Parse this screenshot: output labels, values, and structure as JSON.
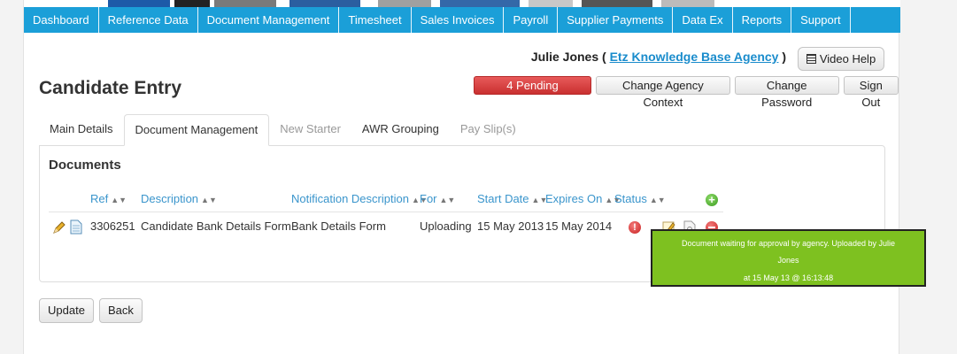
{
  "nav": {
    "items": [
      "Dashboard",
      "Reference Data",
      "Document Management",
      "Timesheet",
      "Sales Invoices",
      "Payroll",
      "Supplier Payments",
      "Data Ex",
      "Reports",
      "Support"
    ]
  },
  "header": {
    "user_name": "Julie Jones (",
    "agency": "Etz Knowledge Base Agency",
    "close_paren": ")",
    "video_help": "Video Help",
    "title": "Candidate Entry",
    "pending_messages": "4 Pending Messages",
    "change_agency": "Change Agency Context",
    "change_password": "Change Password",
    "sign_out": "Sign Out"
  },
  "tabs": [
    "Main Details",
    "Document Management",
    "New Starter",
    "AWR Grouping",
    "Pay Slip(s)"
  ],
  "documents": {
    "heading": "Documents",
    "columns": {
      "ref": "Ref",
      "description": "Description",
      "notification": "Notification Description",
      "for": "For",
      "start": "Start Date",
      "expires": "Expires On",
      "status": "Status"
    },
    "rows": [
      {
        "ref": "3306251",
        "description": "Candidate Bank Details Form",
        "notification": "Bank Details Form",
        "for": "Uploading",
        "start": "15 May 2013",
        "expires": "15 May 2014",
        "status_icon": "alert-icon"
      }
    ],
    "tooltip": {
      "line1": "Document waiting for approval by agency. Uploaded by Julie",
      "line2": "Jones",
      "line3": "at 15 May 13 @ 16:13:48"
    }
  },
  "footer": {
    "update": "Update",
    "back": "Back"
  },
  "colors": {
    "nav": "#1b9fd8",
    "link": "#3a95cc",
    "pending": "#d43b3b",
    "tooltip": "#7ec120"
  }
}
